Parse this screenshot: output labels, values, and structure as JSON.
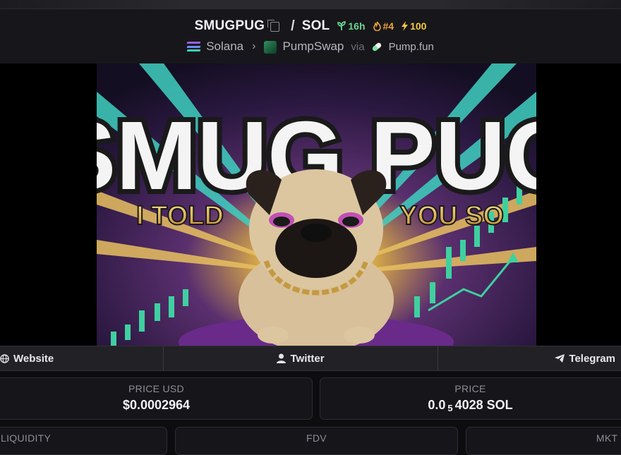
{
  "header": {
    "base_symbol": "SMUGPUG",
    "separator": "/",
    "quote_symbol": "SOL",
    "age": "16h",
    "rank": "#4",
    "boost": "100",
    "chain": "Solana",
    "dex": "PumpSwap",
    "via": "via",
    "launchpad": "Pump.fun"
  },
  "banner": {
    "title": "SMUG PUG",
    "tagline_left": "I TOLD",
    "tagline_right": "YOU SO"
  },
  "links": {
    "website": "Website",
    "twitter": "Twitter",
    "telegram": "Telegram"
  },
  "stats": {
    "price_usd_label": "PRICE USD",
    "price_usd": "$0.0002964",
    "price_label": "PRICE",
    "price_prefix": "0.0",
    "price_zeros": "5",
    "price_digits": "4028 SOL",
    "liquidity_label": "LIQUIDITY",
    "fdv_label": "FDV",
    "mkt_cap_label": "MKT CAP"
  },
  "colors": {
    "age_green": "#68d391",
    "rank_orange": "#f0a43a",
    "boost_yellow": "#f5c842",
    "purple": "#6a2a8a",
    "teal": "#3fd0c0"
  }
}
